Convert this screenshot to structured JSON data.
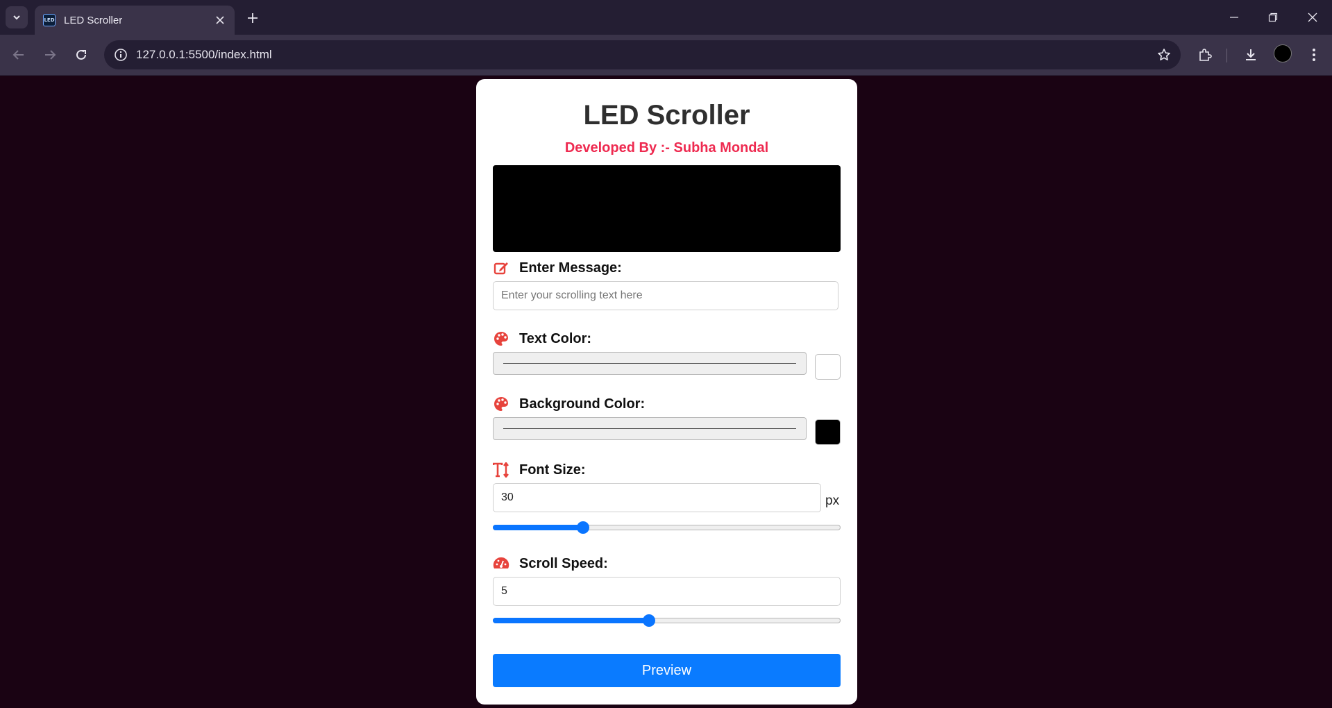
{
  "browser": {
    "tab_title": "LED Scroller",
    "favicon_text": "LED",
    "url": "127.0.0.1:5500/index.html"
  },
  "page": {
    "title": "LED Scroller",
    "developer": "Developed By :- Subha Mondal",
    "message": {
      "label": "Enter Message:",
      "placeholder": "Enter your scrolling text here",
      "value": ""
    },
    "text_color": {
      "label": "Text Color:",
      "value": "#ffffff"
    },
    "background_color": {
      "label": "Background Color:",
      "value": "#000000"
    },
    "font_size": {
      "label": "Font Size:",
      "value": "30",
      "unit": "px",
      "slider_fraction": 0.26
    },
    "scroll_speed": {
      "label": "Scroll Speed:",
      "value": "5",
      "slider_fraction": 0.45
    },
    "preview_label": "Preview"
  },
  "colors": {
    "accent": "#0a7bff",
    "brand_red": "#ee2a50",
    "page_bg": "#1a0313"
  }
}
